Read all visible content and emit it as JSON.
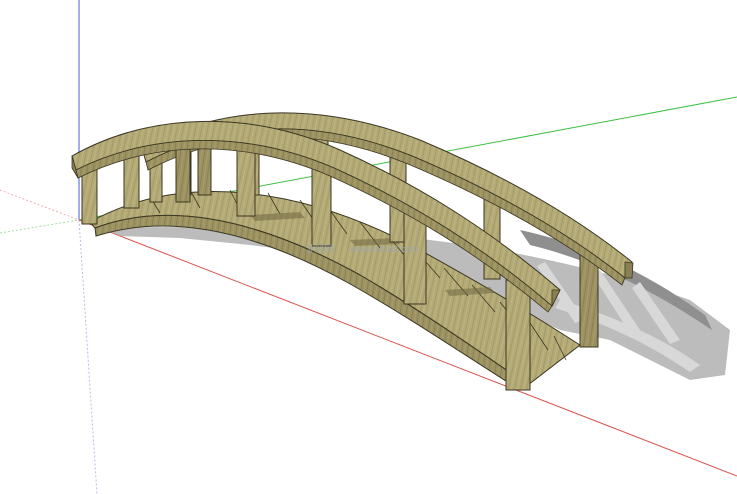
{
  "scene": {
    "model": "wooden-arched-footbridge",
    "axes": {
      "red_axis_color": "#d9534f",
      "green_axis_color": "#3fbf3f",
      "blue_axis_color": "#4a5bd4"
    },
    "colors": {
      "wood_light": "#b7ad7a",
      "wood_mid": "#a39866",
      "wood_dark": "#857b4e",
      "outline": "#3b3722",
      "shadow": "#9c9c9c",
      "background": "#ffffff"
    }
  },
  "watermark": {
    "site_name": "沐风网",
    "url": "www.mfcad.com"
  }
}
